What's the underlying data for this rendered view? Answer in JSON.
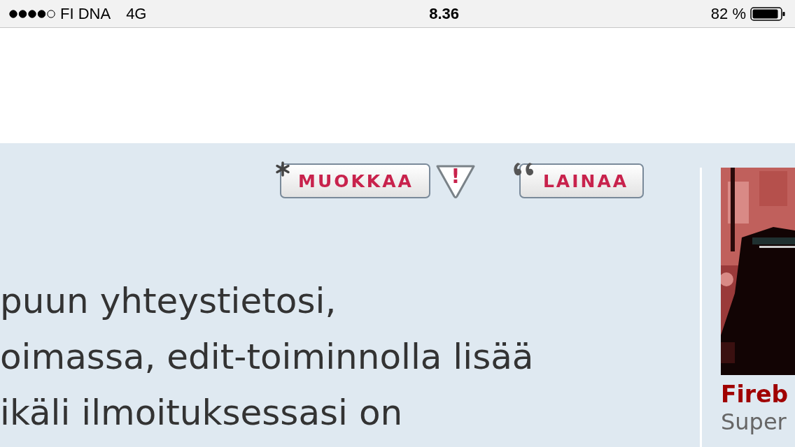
{
  "status_bar": {
    "carrier": "FI DNA",
    "network": "4G",
    "time": "8.36",
    "battery": "82 %"
  },
  "post": {
    "actions": [
      {
        "kind": "edit",
        "label": "MUOKKAA"
      },
      {
        "kind": "report",
        "label": "!"
      },
      {
        "kind": "quote",
        "label": "LAINAA"
      }
    ],
    "text_lines": [
      "puun yhteystietosi,",
      "oimassa, edit-toiminnolla lisää",
      "ikäli ilmoituksessasi on"
    ]
  },
  "author": {
    "name": "Fireb",
    "rank": "Super"
  }
}
